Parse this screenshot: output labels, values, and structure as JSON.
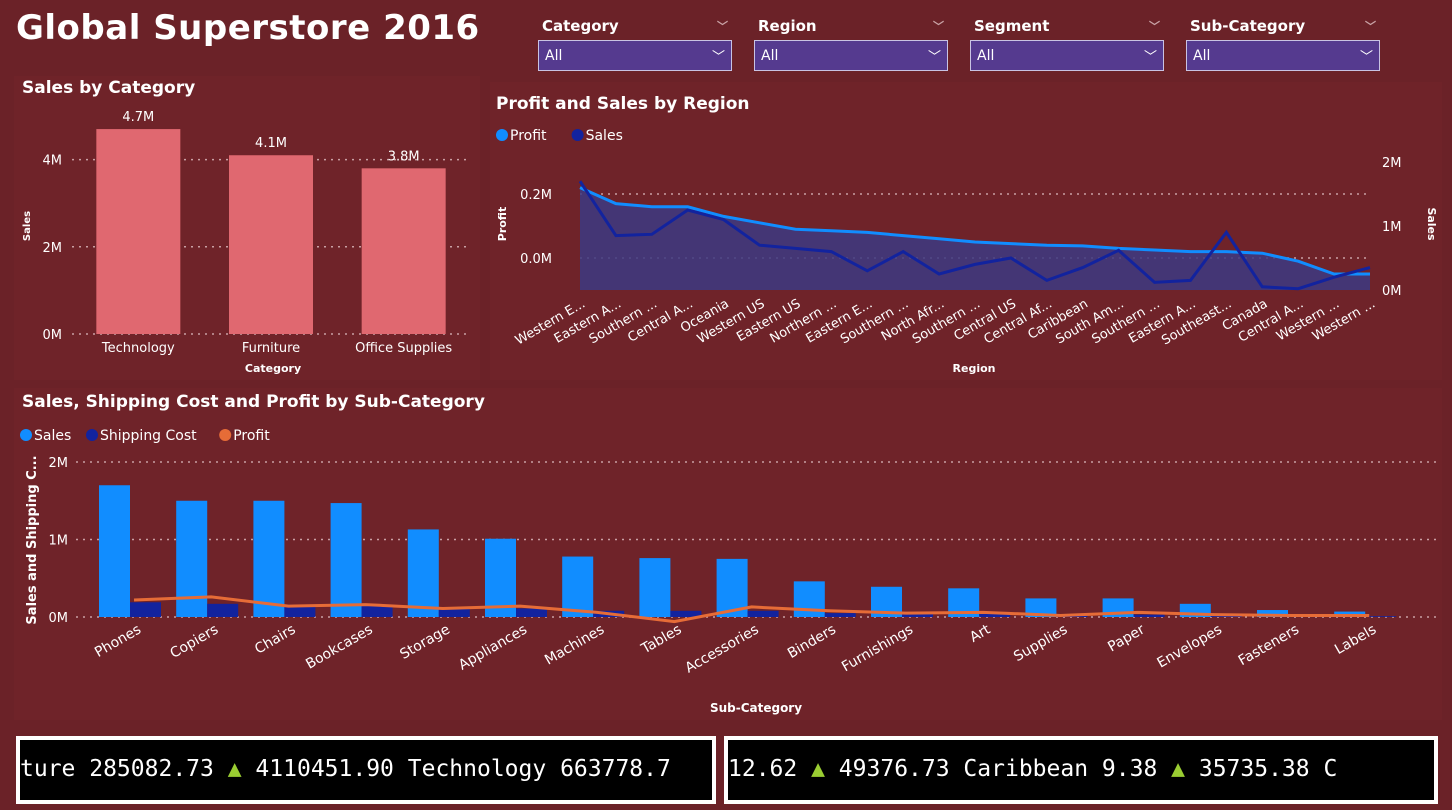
{
  "title": "Global Superstore 2016",
  "slicers": [
    {
      "label": "Category",
      "value": "All"
    },
    {
      "label": "Region",
      "value": "All"
    },
    {
      "label": "Segment",
      "value": "All"
    },
    {
      "label": "Sub-Category",
      "value": "All"
    }
  ],
  "panel_titles": {
    "category": "Sales by Category",
    "region": "Profit and Sales by Region",
    "subcat": "Sales, Shipping Cost and Profit by Sub-Category"
  },
  "tickers": [
    {
      "parts": [
        {
          "text": "ture 285082.73 "
        },
        {
          "text": "▲",
          "tri": true
        },
        {
          "text": " 4110451.90      Technology 663778.7"
        }
      ]
    },
    {
      "parts": [
        {
          "text": "12.62 "
        },
        {
          "text": "▲",
          "tri": true
        },
        {
          "text": " 49376.73      Caribbean 9.38 "
        },
        {
          "text": "▲",
          "tri": true
        },
        {
          "text": " 35735.38      C"
        }
      ]
    }
  ],
  "chart_data": [
    {
      "type": "bar",
      "title": "Sales by Category",
      "xlabel": "Category",
      "ylabel": "Sales",
      "categories": [
        "Technology",
        "Furniture",
        "Office Supplies"
      ],
      "values": [
        4.7,
        4.1,
        3.8
      ],
      "data_labels": [
        "4.7M",
        "4.1M",
        "3.8M"
      ],
      "yticks": [
        "0M",
        "2M",
        "4M"
      ],
      "ylim": [
        0,
        5
      ],
      "color": "#e06870"
    },
    {
      "type": "line",
      "title": "Profit and Sales by Region",
      "xlabel": "Region",
      "ylabel": "Profit",
      "y2label": "Sales",
      "legend": [
        {
          "name": "Profit",
          "color": "#118dff"
        },
        {
          "name": "Sales",
          "color": "#12239e"
        }
      ],
      "categories": [
        "Western E...",
        "Eastern A...",
        "Southern ...",
        "Central A...",
        "Oceania",
        "Western US",
        "Eastern US",
        "Northern ...",
        "Eastern E...",
        "Southern ...",
        "North Afr...",
        "Southern ...",
        "Central US",
        "Central Af...",
        "Caribbean",
        "South Am...",
        "Southern ...",
        "Eastern A...",
        "Southeast...",
        "Canada",
        "Central A...",
        "Western ...",
        "Western ..."
      ],
      "series": [
        {
          "name": "Profit",
          "axis": "left",
          "values": [
            0.22,
            0.17,
            0.16,
            0.16,
            0.13,
            0.11,
            0.09,
            0.085,
            0.08,
            0.07,
            0.06,
            0.05,
            0.045,
            0.04,
            0.038,
            0.03,
            0.025,
            0.02,
            0.02,
            0.015,
            -0.01,
            -0.05,
            -0.05
          ]
        },
        {
          "name": "Sales",
          "axis": "right",
          "values": [
            1.7,
            0.85,
            0.87,
            1.25,
            1.1,
            0.7,
            0.65,
            0.6,
            0.3,
            0.6,
            0.25,
            0.4,
            0.5,
            0.15,
            0.35,
            0.62,
            0.12,
            0.15,
            0.9,
            0.05,
            0.02,
            0.2,
            0.35
          ]
        }
      ],
      "yticks": [
        "0.0M",
        "0.2M"
      ],
      "ylim": [
        -0.1,
        0.3
      ],
      "y2ticks": [
        "0M",
        "1M",
        "2M"
      ],
      "y2lim": [
        0,
        2
      ]
    },
    {
      "type": "bar",
      "title": "Sales, Shipping Cost and Profit by Sub-Category",
      "xlabel": "Sub-Category",
      "ylabel": "Sales and Shipping C...",
      "legend": [
        {
          "name": "Sales",
          "color": "#118dff"
        },
        {
          "name": "Shipping Cost",
          "color": "#12239e"
        },
        {
          "name": "Profit",
          "color": "#e66c37"
        }
      ],
      "categories": [
        "Phones",
        "Copiers",
        "Chairs",
        "Bookcases",
        "Storage",
        "Appliances",
        "Machines",
        "Tables",
        "Accessories",
        "Binders",
        "Furnishings",
        "Art",
        "Supplies",
        "Paper",
        "Envelopes",
        "Fasteners",
        "Labels"
      ],
      "series": [
        {
          "name": "Sales",
          "values": [
            1.7,
            1.5,
            1.5,
            1.47,
            1.13,
            1.01,
            0.78,
            0.76,
            0.75,
            0.46,
            0.39,
            0.37,
            0.24,
            0.24,
            0.17,
            0.09,
            0.07
          ]
        },
        {
          "name": "Shipping Cost",
          "values": [
            0.19,
            0.17,
            0.16,
            0.15,
            0.12,
            0.11,
            0.08,
            0.08,
            0.08,
            0.05,
            0.04,
            0.04,
            0.03,
            0.03,
            0.02,
            0.01,
            0.01
          ]
        },
        {
          "name": "Profit",
          "values": [
            0.22,
            0.26,
            0.14,
            0.16,
            0.11,
            0.14,
            0.06,
            -0.06,
            0.13,
            0.08,
            0.05,
            0.06,
            0.02,
            0.06,
            0.03,
            0.02,
            0.02
          ]
        }
      ],
      "yticks": [
        "0M",
        "1M",
        "2M"
      ],
      "ylim": [
        0,
        2
      ]
    }
  ]
}
